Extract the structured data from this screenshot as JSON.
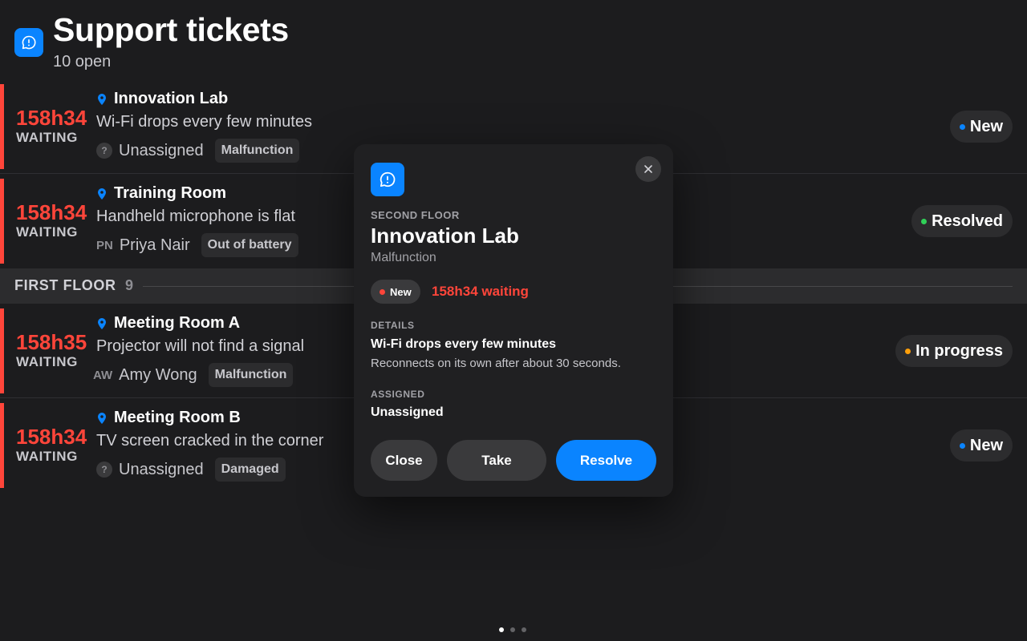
{
  "header": {
    "title": "Support tickets",
    "subtitle": "10 open",
    "icon": "chat-alert-icon"
  },
  "tickets": [
    {
      "time": "158h34",
      "waiting": "WAITING",
      "location": "Innovation Lab",
      "description": "Wi-Fi drops every few minutes",
      "assignee_badge": "?",
      "assignee": "Unassigned",
      "tag": "Malfunction",
      "status": "New",
      "status_color": "#0a84ff"
    },
    {
      "time": "158h34",
      "waiting": "WAITING",
      "location": "Training Room",
      "description": "Handheld microphone is flat",
      "assignee_badge": "PN",
      "assignee": "Priya Nair",
      "tag": "Out of battery",
      "status": "Resolved",
      "status_color": "#30d158"
    },
    {
      "time": "158h35",
      "waiting": "WAITING",
      "location": "Meeting Room A",
      "description": "Projector will not find a signal",
      "assignee_badge": "AW",
      "assignee": "Amy Wong",
      "tag": "Malfunction",
      "status": "In progress",
      "status_color": "#ff9f0a"
    },
    {
      "time": "158h34",
      "waiting": "WAITING",
      "location": "Meeting Room B",
      "description": "TV screen cracked in the corner",
      "assignee_badge": "?",
      "assignee": "Unassigned",
      "tag": "Damaged",
      "status": "New",
      "status_color": "#0a84ff"
    }
  ],
  "section": {
    "label": "FIRST FLOOR",
    "count": "9"
  },
  "modal": {
    "floor": "SECOND FLOOR",
    "title": "Innovation Lab",
    "type": "Malfunction",
    "status": "New",
    "status_color": "#ff453a",
    "waiting": "158h34 waiting",
    "details_label": "DETAILS",
    "details_title": "Wi-Fi drops every few minutes",
    "details_body": "Reconnects on its own after about 30 seconds.",
    "assigned_label": "ASSIGNED",
    "assigned_value": "Unassigned",
    "buttons": {
      "close": "Close",
      "take": "Take",
      "resolve": "Resolve"
    }
  },
  "pager": {
    "pages": 3,
    "active": 1
  },
  "colors": {
    "accent": "#0a84ff",
    "urgent": "#ff453a",
    "background": "#1c1c1e"
  }
}
